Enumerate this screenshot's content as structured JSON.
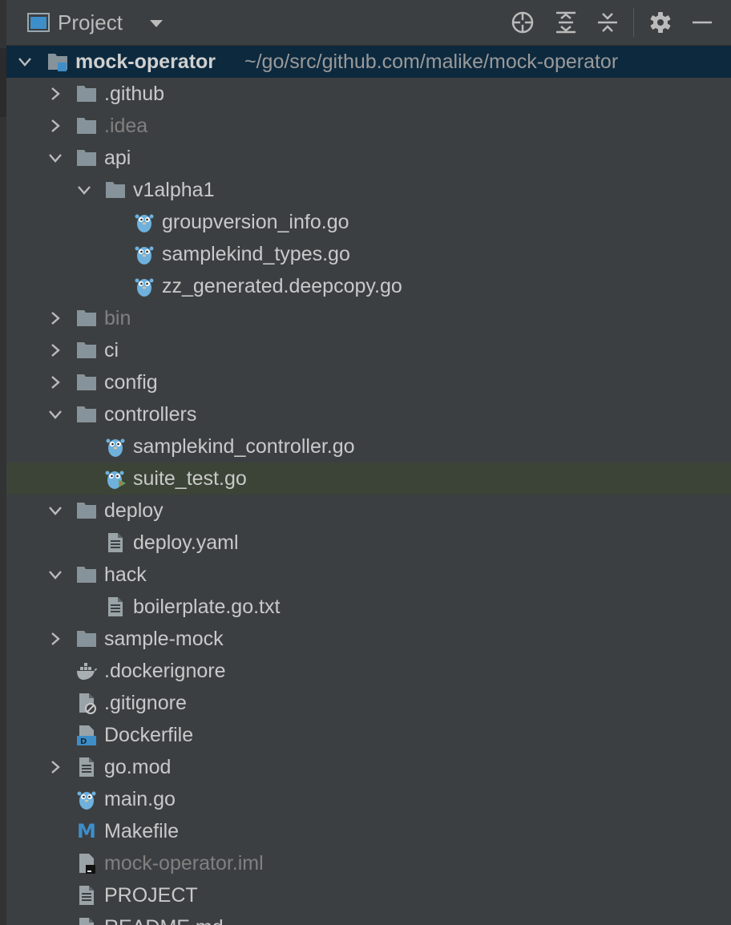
{
  "panel": {
    "title": "Project",
    "toolbar_icons": [
      "locate-icon",
      "expand-all-icon",
      "collapse-all-icon",
      "gear-icon",
      "hide-icon"
    ]
  },
  "tree": {
    "root": {
      "name": "mock-operator",
      "path": "~/go/src/github.com/malike/mock-operator"
    },
    "items": [
      {
        "label": ".github",
        "type": "folder",
        "state": "collapsed"
      },
      {
        "label": ".idea",
        "type": "folder",
        "state": "collapsed",
        "dim": true
      },
      {
        "label": "api",
        "type": "folder",
        "state": "expanded"
      },
      {
        "label": "v1alpha1",
        "type": "folder",
        "state": "expanded"
      },
      {
        "label": "groupversion_info.go",
        "type": "go-file"
      },
      {
        "label": "samplekind_types.go",
        "type": "go-file"
      },
      {
        "label": "zz_generated.deepcopy.go",
        "type": "go-file"
      },
      {
        "label": "bin",
        "type": "folder",
        "state": "collapsed",
        "dim": true
      },
      {
        "label": "ci",
        "type": "folder",
        "state": "collapsed"
      },
      {
        "label": "config",
        "type": "folder",
        "state": "collapsed"
      },
      {
        "label": "controllers",
        "type": "folder",
        "state": "expanded"
      },
      {
        "label": "samplekind_controller.go",
        "type": "go-file"
      },
      {
        "label": "suite_test.go",
        "type": "go-test-file",
        "selected": true
      },
      {
        "label": "deploy",
        "type": "folder",
        "state": "expanded"
      },
      {
        "label": "deploy.yaml",
        "type": "text-file"
      },
      {
        "label": "hack",
        "type": "folder",
        "state": "expanded"
      },
      {
        "label": "boilerplate.go.txt",
        "type": "text-file"
      },
      {
        "label": "sample-mock",
        "type": "folder",
        "state": "collapsed"
      },
      {
        "label": ".dockerignore",
        "type": "docker-ignore-file"
      },
      {
        "label": ".gitignore",
        "type": "ignore-file"
      },
      {
        "label": "Dockerfile",
        "type": "dockerfile"
      },
      {
        "label": "go.mod",
        "type": "text-file",
        "state": "collapsed"
      },
      {
        "label": "main.go",
        "type": "go-file"
      },
      {
        "label": "Makefile",
        "type": "makefile"
      },
      {
        "label": "mock-operator.iml",
        "type": "iml-file",
        "dim": true
      },
      {
        "label": "PROJECT",
        "type": "text-file"
      },
      {
        "label": "README.md",
        "type": "text-file"
      }
    ]
  },
  "colors": {
    "background": "#3c3f41",
    "root_highlight": "#0d293e",
    "selected_row": "#3b4436",
    "folder": "#87939a",
    "gopher": "#6fb1dd",
    "text": "#c9c9c9",
    "dim_text": "#808080"
  }
}
